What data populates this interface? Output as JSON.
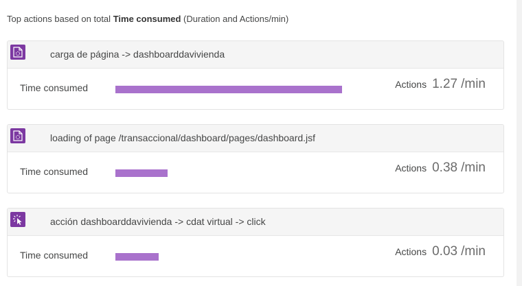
{
  "intro": {
    "prefix": "Top actions based on total",
    "emphasis": "Time consumed",
    "suffix": "(Duration and Actions/min)"
  },
  "colors": {
    "icon_bg": "#7c38a1",
    "bar": "#a972cc"
  },
  "actions": [
    {
      "icon": "page-load-icon",
      "name": "carga de página -> dashboarddavivienda",
      "time_label": "Time consumed",
      "time_share": 1.0,
      "actions_label": "Actions",
      "rate": "1.27",
      "unit": "/min"
    },
    {
      "icon": "page-load-icon",
      "name": "loading of page /transaccional/dashboard/pages/dashboard.jsf",
      "time_label": "Time consumed",
      "time_share": 0.23,
      "actions_label": "Actions",
      "rate": "0.38",
      "unit": "/min"
    },
    {
      "icon": "click-action-icon",
      "name": "acción dashboarddavivienda -> cdat virtual -> click",
      "time_label": "Time consumed",
      "time_share": 0.19,
      "actions_label": "Actions",
      "rate": "0.03",
      "unit": "/min"
    }
  ]
}
